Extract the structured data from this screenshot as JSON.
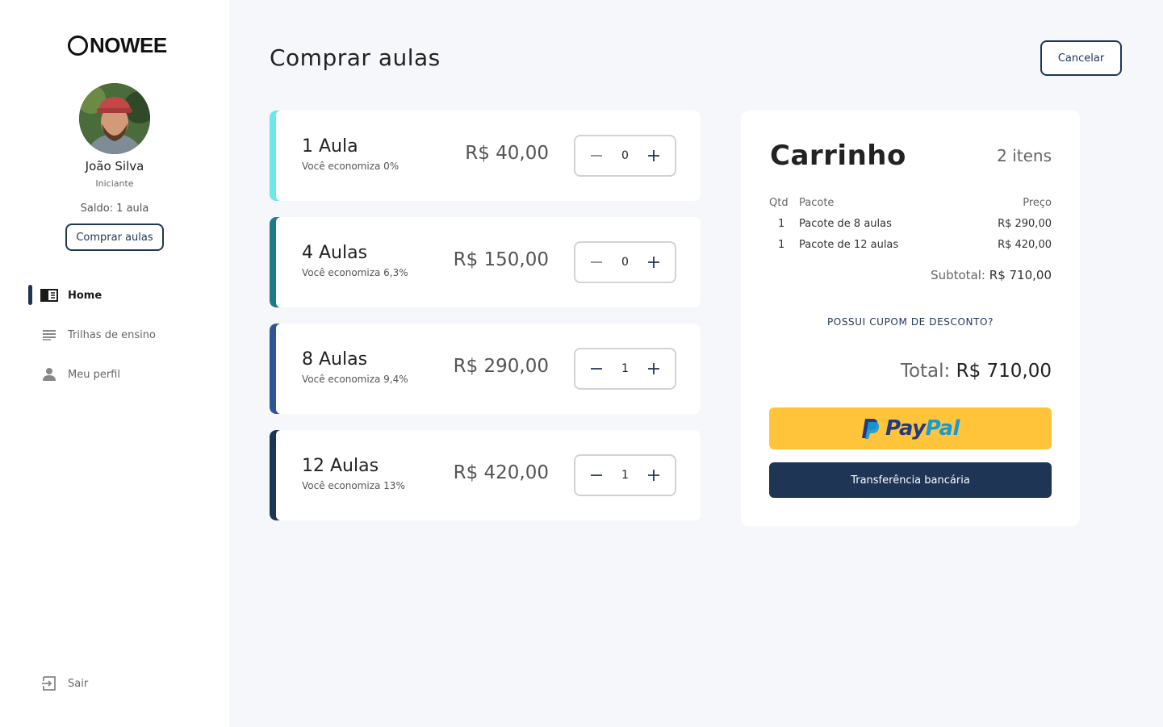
{
  "brand": {
    "logo_text": "NOWEE"
  },
  "user": {
    "name": "João Silva",
    "level": "Iniciante",
    "balance": "Saldo: 1 aula"
  },
  "sidebar": {
    "buy_button": "Comprar aulas",
    "items": [
      {
        "label": "Home",
        "icon": "home-book-icon",
        "active": true
      },
      {
        "label": "Trilhas de ensino",
        "icon": "list-icon",
        "active": false
      },
      {
        "label": "Meu perfil",
        "icon": "person-icon",
        "active": false
      }
    ],
    "logout": {
      "label": "Sair",
      "icon": "logout-icon"
    }
  },
  "header": {
    "title": "Comprar aulas",
    "cancel_label": "Cancelar"
  },
  "packages": [
    {
      "name": "1 Aula",
      "savings": "Você economiza 0%",
      "price": "R$ 40,00",
      "qty": "0",
      "color": "#6ee7ea"
    },
    {
      "name": "4 Aulas",
      "savings": "Você economiza 6,3%",
      "price": "R$ 150,00",
      "qty": "0",
      "color": "#1f7a87"
    },
    {
      "name": "8 Aulas",
      "savings": "Você economiza 9,4%",
      "price": "R$ 290,00",
      "qty": "1",
      "color": "#2e5494"
    },
    {
      "name": "12 Aulas",
      "savings": "Você economiza 13%",
      "price": "R$ 420,00",
      "qty": "1",
      "color": "#1f3556"
    }
  ],
  "cart": {
    "title": "Carrinho",
    "count": "2 itens",
    "headers": {
      "qty": "Qtd",
      "package": "Pacote",
      "price": "Preço"
    },
    "rows": [
      {
        "qty": "1",
        "package": "Pacote de 8 aulas",
        "price": "R$ 290,00"
      },
      {
        "qty": "1",
        "package": "Pacote de 12 aulas",
        "price": "R$ 420,00"
      }
    ],
    "subtotal_label": "Subtotal:",
    "subtotal_value": "R$ 710,00",
    "coupon_label": "POSSUI CUPOM DE DESCONTO?",
    "total_label": "Total:",
    "total_value": "R$ 710,00",
    "paypal_label_1": "Pay",
    "paypal_label_2": "Pal",
    "transfer_label": "Transferência bancária"
  },
  "colors": {
    "primary": "#1f3556",
    "paypal_yellow": "#ffc43a",
    "background": "#f5f7fa"
  }
}
